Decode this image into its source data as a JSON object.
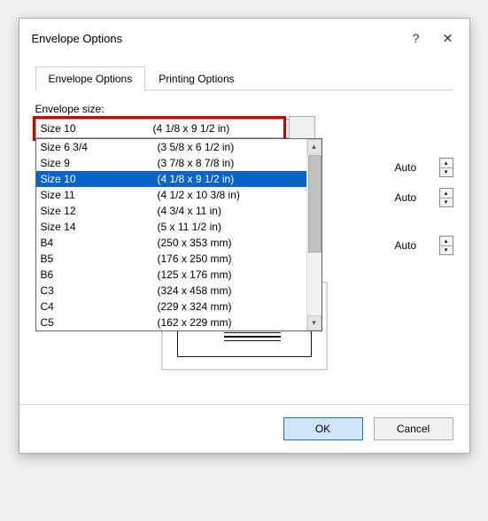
{
  "titlebar": {
    "title": "Envelope Options"
  },
  "tabs": {
    "options": "Envelope Options",
    "printing": "Printing Options"
  },
  "size_label": "Envelope size:",
  "selected": {
    "name": "Size 10",
    "dim": "(4 1/8 x 9 1/2 in)"
  },
  "dropdown": [
    {
      "name": "Size 6 3/4",
      "dim": "(3 5/8 x 6 1/2 in)"
    },
    {
      "name": "Size 9",
      "dim": "(3 7/8 x 8 7/8 in)"
    },
    {
      "name": "Size 10",
      "dim": "(4 1/8 x 9 1/2 in)",
      "selected": true
    },
    {
      "name": "Size 11",
      "dim": "(4 1/2 x 10 3/8 in)"
    },
    {
      "name": "Size 12",
      "dim": "(4 3/4 x 11 in)"
    },
    {
      "name": "Size 14",
      "dim": "(5 x 11 1/2 in)"
    },
    {
      "name": "B4",
      "dim": "(250 x 353 mm)"
    },
    {
      "name": "B5",
      "dim": "(176 x 250 mm)"
    },
    {
      "name": "B6",
      "dim": "(125 x 176 mm)"
    },
    {
      "name": "C3",
      "dim": "(324 x 458 mm)"
    },
    {
      "name": "C4",
      "dim": "(229 x 324 mm)"
    },
    {
      "name": "C5",
      "dim": "(162 x 229 mm)"
    }
  ],
  "auto_rows": [
    {
      "label": "Auto"
    },
    {
      "label": "Auto"
    },
    {
      "label": "Auto"
    }
  ],
  "buttons": {
    "ok": "OK",
    "cancel": "Cancel"
  }
}
